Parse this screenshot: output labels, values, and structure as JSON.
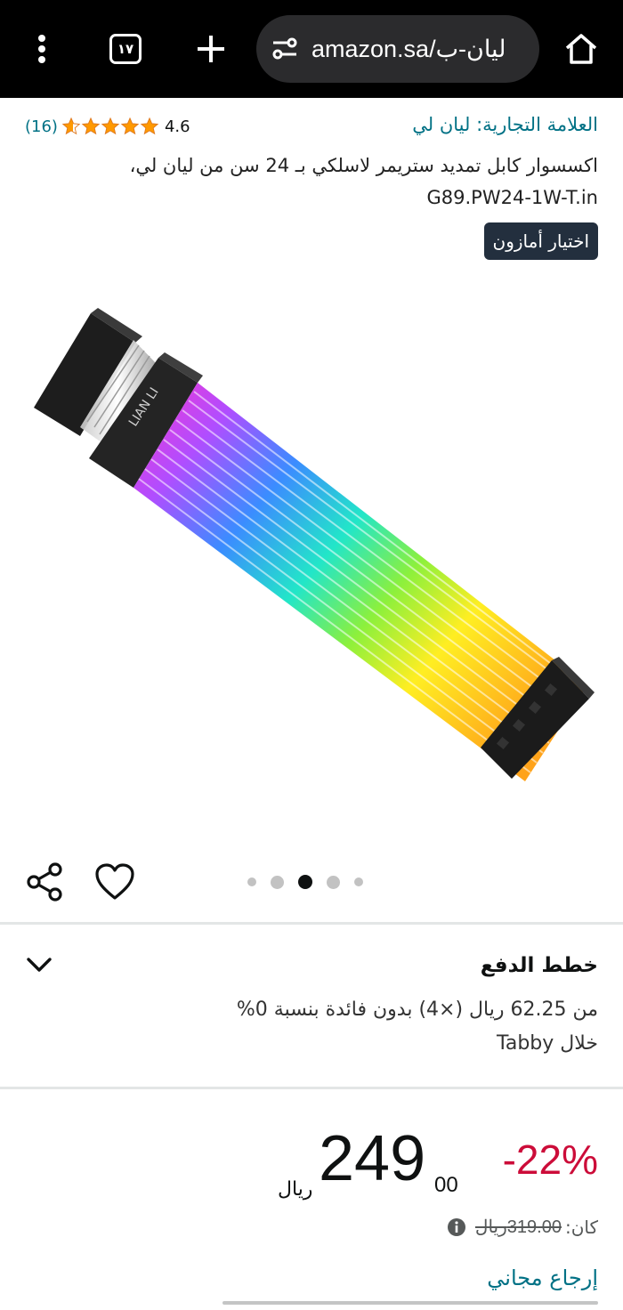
{
  "browser": {
    "url": "amazon.sa/ليان-ب",
    "tab_count": "١٧",
    "icons": [
      "menu-dots-icon",
      "tab-switcher-icon",
      "plus-icon",
      "site-settings-icon",
      "home-icon"
    ]
  },
  "product": {
    "brand_label": "العلامة التجارية: ليان لي",
    "rating": "4.6",
    "rating_count": "(16)",
    "title_line1": "اكسسوار كابل تمديد ستريمر لاسلكي بـ 24 سن من ليان لي،",
    "title_line2": "G89.PW24-1W-T.in",
    "badge": "اختيار أمازون",
    "image": "rgb-24-pin-extension-cable",
    "image_logo_text": "LIAN LI",
    "image_dots": 5,
    "active_dot": 3
  },
  "payment_plans": {
    "title": "خطط الدفع",
    "line1": "من 62.25 ريال (×4) بدون فائدة بنسبة 0%",
    "line2": "خلال Tabby"
  },
  "price": {
    "discount": "-22%",
    "whole": "249",
    "fraction": "00",
    "currency": "ريال",
    "was_label": "كان:",
    "was_price": "319.00ريال",
    "free_returns": "إرجاع مجاني"
  },
  "colors": {
    "accent_link": "#007185",
    "discount_red": "#cc0c39",
    "badge_bg": "#232f3e",
    "star_orange": "#ff9900"
  }
}
